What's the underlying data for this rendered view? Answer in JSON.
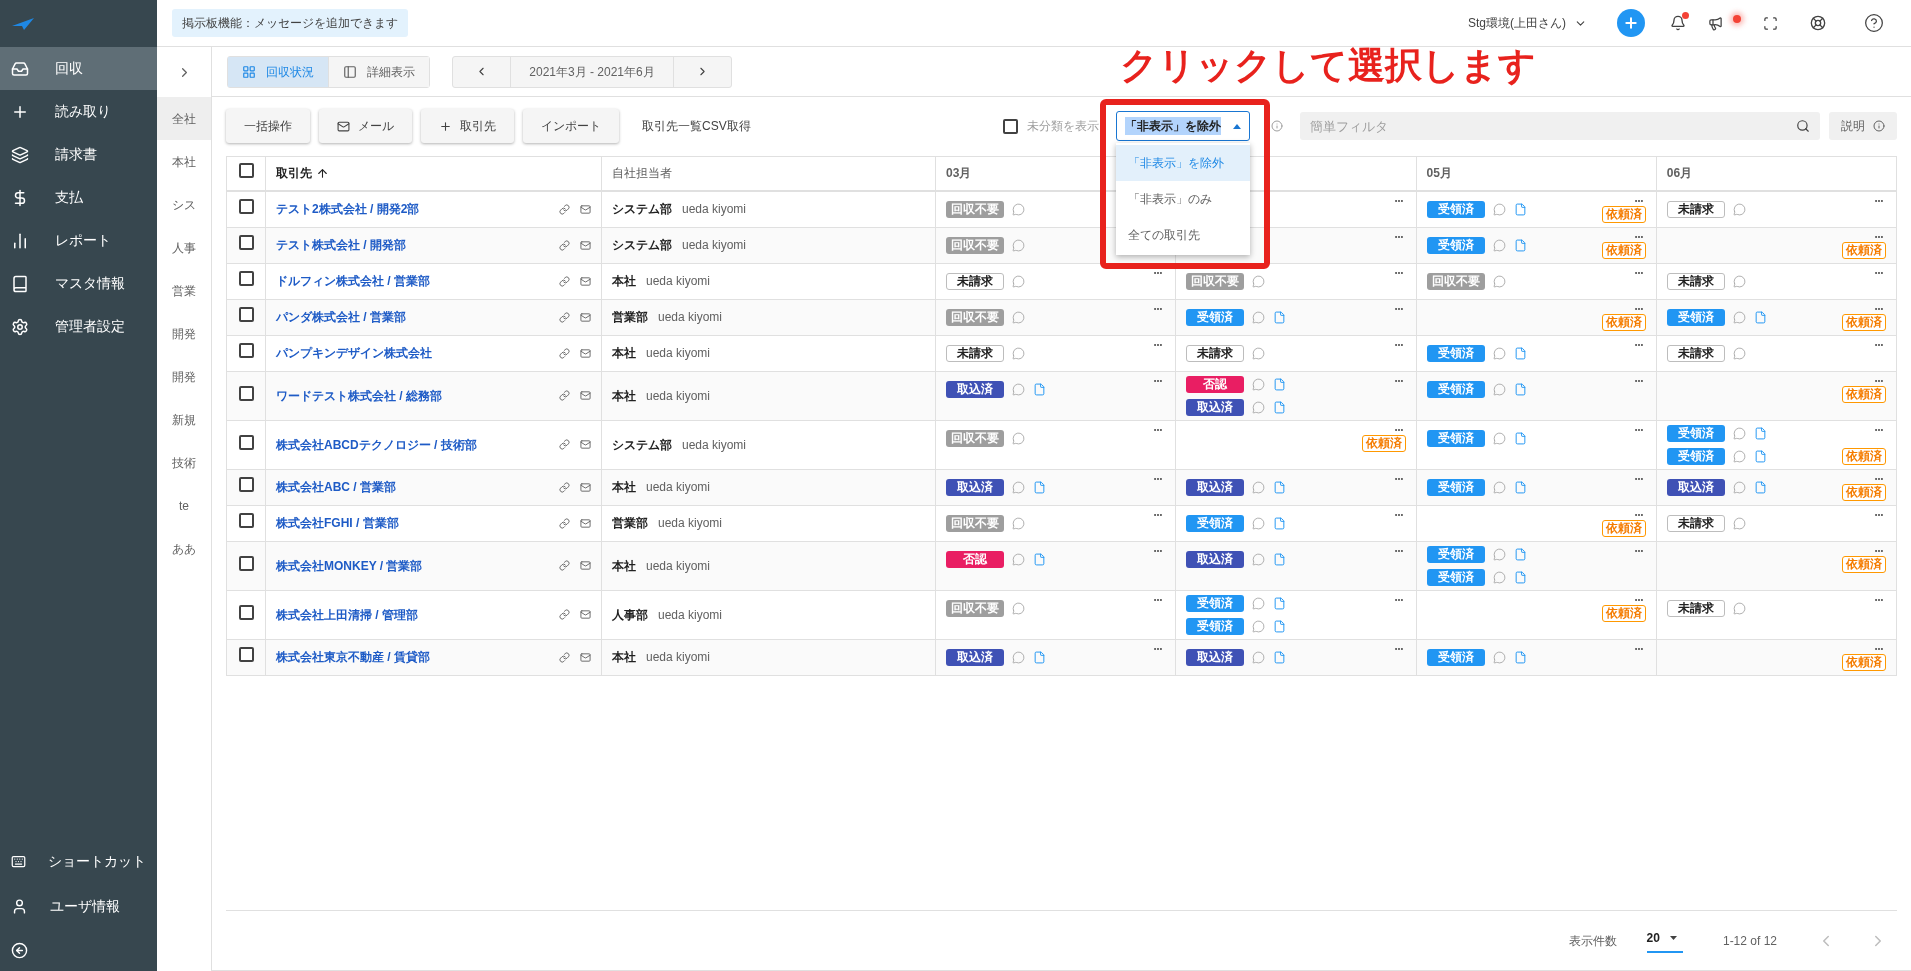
{
  "nav": {
    "items": [
      {
        "label": "回収",
        "selected": true
      },
      {
        "label": "読み取り",
        "selected": false
      },
      {
        "label": "請求書",
        "selected": false
      },
      {
        "label": "支払",
        "selected": false
      },
      {
        "label": "レポート",
        "selected": false
      },
      {
        "label": "マスタ情報",
        "selected": false
      },
      {
        "label": "管理者設定",
        "selected": false
      }
    ],
    "bottom_items": [
      {
        "label": "ショートカット"
      },
      {
        "label": "ユーザ情報"
      }
    ]
  },
  "top_bar": {
    "notice": "掲示板機能：メッセージを追加できます",
    "environment": "Stg環境(上田さん)"
  },
  "groups": [
    {
      "label": "全社",
      "selected": true
    },
    {
      "label": "本社",
      "selected": false
    },
    {
      "label": "シス",
      "selected": false
    },
    {
      "label": "人事",
      "selected": false
    },
    {
      "label": "営業",
      "selected": false
    },
    {
      "label": "開発",
      "selected": false
    },
    {
      "label": "開発",
      "selected": false
    },
    {
      "label": "新規",
      "selected": false
    },
    {
      "label": "技術",
      "selected": false
    },
    {
      "label": "te",
      "selected": false
    },
    {
      "label": "ああ",
      "selected": false
    }
  ],
  "view_tabs": [
    {
      "label": "回収状況",
      "selected": true
    },
    {
      "label": "詳細表示",
      "selected": false
    }
  ],
  "period": "2021年3月 - 2021年6月",
  "annotation": "クリックして選択します",
  "toolbar": {
    "buttons": [
      "一括操作",
      "メール",
      "取引先",
      "インポート"
    ],
    "csv_link": "取引先一覧CSV取得",
    "show_unclassified": {
      "label": "未分類を表示",
      "checked": false
    },
    "visibility_select": {
      "value": "「非表示」を除外",
      "expanded": true,
      "options": [
        {
          "label": "「非表示」を除外",
          "selected": true
        },
        {
          "label": "「非表示」のみ",
          "selected": false
        },
        {
          "label": "全ての取引先",
          "selected": false
        }
      ]
    },
    "filter": {
      "placeholder": "簡単フィルタ"
    },
    "help_button": "説明"
  },
  "table": {
    "select_all_checked": false,
    "columns": {
      "client": "取引先",
      "owner": "自社担当者",
      "months": {
        "col_1": "03月",
        "col_3": "05月",
        "col_4": "06月"
      }
    },
    "rows": [
      {
        "client": "テスト2株式会社 / 開発2部",
        "dept": "システム部",
        "person": "ueda kiyomi",
        "checked": false,
        "months": [
          {
            "entries": [
              {
                "kind": "not_needed",
                "label": "回収不要"
              }
            ],
            "requested": false
          },
          {
            "requested": false
          },
          {
            "entries": [
              {
                "kind": "received",
                "label": "受領済"
              }
            ],
            "requested": true,
            "tag": "依頼済"
          },
          {
            "entries": [
              {
                "kind": "unbilled",
                "label": "未請求"
              }
            ],
            "requested": false
          }
        ]
      },
      {
        "client": "テスト株式会社 / 開発部",
        "dept": "システム部",
        "person": "ueda kiyomi",
        "checked": false,
        "months": [
          {
            "entries": [
              {
                "kind": "not_needed",
                "label": "回収不要"
              }
            ],
            "requested": false
          },
          {
            "requested": false
          },
          {
            "entries": [
              {
                "kind": "received",
                "label": "受領済"
              }
            ],
            "requested": true,
            "tag": "依頼済"
          },
          {
            "requested": true,
            "tag": "依頼済"
          }
        ]
      },
      {
        "client": "ドルフィン株式会社 / 営業部",
        "dept": "本社",
        "person": "ueda kiyomi",
        "checked": false,
        "months": [
          {
            "entries": [
              {
                "kind": "unbilled",
                "label": "未請求"
              }
            ],
            "requested": false
          },
          {
            "entries": [
              {
                "kind": "not_needed",
                "label": "回収不要"
              }
            ],
            "requested": false
          },
          {
            "entries": [
              {
                "kind": "not_needed",
                "label": "回収不要"
              }
            ],
            "requested": false
          },
          {
            "entries": [
              {
                "kind": "unbilled",
                "label": "未請求"
              }
            ],
            "requested": false
          }
        ]
      },
      {
        "client": "パンダ株式会社 / 営業部",
        "dept": "営業部",
        "person": "ueda kiyomi",
        "checked": false,
        "months": [
          {
            "entries": [
              {
                "kind": "not_needed",
                "label": "回収不要"
              }
            ],
            "requested": false
          },
          {
            "entries": [
              {
                "kind": "received",
                "label": "受領済"
              }
            ],
            "requested": false
          },
          {
            "requested": true,
            "tag": "依頼済"
          },
          {
            "entries": [
              {
                "kind": "received",
                "label": "受領済"
              }
            ],
            "requested": true,
            "tag": "依頼済"
          }
        ]
      },
      {
        "client": "パンプキンデザイン株式会社",
        "dept": "本社",
        "person": "ueda kiyomi",
        "checked": false,
        "months": [
          {
            "entries": [
              {
                "kind": "unbilled",
                "label": "未請求"
              }
            ],
            "requested": false
          },
          {
            "entries": [
              {
                "kind": "unbilled",
                "label": "未請求"
              }
            ],
            "requested": false
          },
          {
            "entries": [
              {
                "kind": "received",
                "label": "受領済"
              }
            ],
            "requested": false
          },
          {
            "entries": [
              {
                "kind": "unbilled",
                "label": "未請求"
              }
            ],
            "requested": false
          }
        ]
      },
      {
        "client": "ワードテスト株式会社 / 総務部",
        "dept": "本社",
        "person": "ueda kiyomi",
        "checked": false,
        "months": [
          {
            "entries": [
              {
                "kind": "imported",
                "label": "取込済"
              }
            ],
            "requested": false
          },
          {
            "entries": [
              {
                "kind": "rejected",
                "label": "否認"
              },
              {
                "kind": "imported",
                "label": "取込済"
              }
            ],
            "requested": false
          },
          {
            "entries": [
              {
                "kind": "received",
                "label": "受領済"
              }
            ],
            "requested": false
          },
          {
            "requested": true,
            "tag": "依頼済"
          }
        ]
      },
      {
        "client": "株式会社ABCDテクノロジー / 技術部",
        "dept": "システム部",
        "person": "ueda kiyomi",
        "checked": false,
        "months": [
          {
            "entries": [
              {
                "kind": "not_needed",
                "label": "回収不要"
              }
            ],
            "requested": false
          },
          {
            "requested": true,
            "tag": "依頼済"
          },
          {
            "entries": [
              {
                "kind": "received",
                "label": "受領済"
              }
            ],
            "requested": false
          },
          {
            "entries": [
              {
                "kind": "received",
                "label": "受領済"
              },
              {
                "kind": "received",
                "label": "受領済"
              }
            ],
            "requested": true,
            "tag": "依頼済"
          }
        ]
      },
      {
        "client": "株式会社ABC / 営業部",
        "dept": "本社",
        "person": "ueda kiyomi",
        "checked": false,
        "months": [
          {
            "entries": [
              {
                "kind": "imported",
                "label": "取込済"
              }
            ],
            "requested": false
          },
          {
            "entries": [
              {
                "kind": "imported",
                "label": "取込済"
              }
            ],
            "requested": false
          },
          {
            "entries": [
              {
                "kind": "received",
                "label": "受領済"
              }
            ],
            "requested": false
          },
          {
            "entries": [
              {
                "kind": "imported",
                "label": "取込済"
              }
            ],
            "requested": true,
            "tag": "依頼済"
          }
        ]
      },
      {
        "client": "株式会社FGHI / 営業部",
        "dept": "営業部",
        "person": "ueda kiyomi",
        "checked": false,
        "months": [
          {
            "entries": [
              {
                "kind": "not_needed",
                "label": "回収不要"
              }
            ],
            "requested": false
          },
          {
            "entries": [
              {
                "kind": "received",
                "label": "受領済"
              }
            ],
            "requested": false
          },
          {
            "requested": true,
            "tag": "依頼済"
          },
          {
            "entries": [
              {
                "kind": "unbilled",
                "label": "未請求"
              }
            ],
            "requested": false
          }
        ]
      },
      {
        "client": "株式会社MONKEY / 営業部",
        "dept": "本社",
        "person": "ueda kiyomi",
        "checked": false,
        "months": [
          {
            "entries": [
              {
                "kind": "rejected",
                "label": "否認"
              }
            ],
            "requested": false
          },
          {
            "entries": [
              {
                "kind": "imported",
                "label": "取込済"
              }
            ],
            "requested": false
          },
          {
            "entries": [
              {
                "kind": "received",
                "label": "受領済"
              },
              {
                "kind": "received",
                "label": "受領済"
              }
            ],
            "requested": false
          },
          {
            "requested": true,
            "tag": "依頼済"
          }
        ]
      },
      {
        "client": "株式会社上田清掃 / 管理部",
        "dept": "人事部",
        "person": "ueda kiyomi",
        "checked": false,
        "months": [
          {
            "entries": [
              {
                "kind": "not_needed",
                "label": "回収不要"
              }
            ],
            "requested": false
          },
          {
            "entries": [
              {
                "kind": "received",
                "label": "受領済"
              },
              {
                "kind": "received",
                "label": "受領済"
              }
            ],
            "requested": false
          },
          {
            "requested": true,
            "tag": "依頼済"
          },
          {
            "entries": [
              {
                "kind": "unbilled",
                "label": "未請求"
              }
            ],
            "requested": false
          }
        ]
      },
      {
        "client": "株式会社東京不動産 / 賃貸部",
        "dept": "本社",
        "person": "ueda kiyomi",
        "checked": false,
        "months": [
          {
            "entries": [
              {
                "kind": "imported",
                "label": "取込済"
              }
            ],
            "requested": false
          },
          {
            "entries": [
              {
                "kind": "imported",
                "label": "取込済"
              }
            ],
            "requested": false
          },
          {
            "entries": [
              {
                "kind": "received",
                "label": "受領済"
              }
            ],
            "requested": false
          },
          {
            "requested": true,
            "tag": "依頼済"
          }
        ]
      }
    ]
  },
  "pagination": {
    "rows_label": "表示件数",
    "rows_value": "20",
    "range": "1-12 of 12"
  }
}
